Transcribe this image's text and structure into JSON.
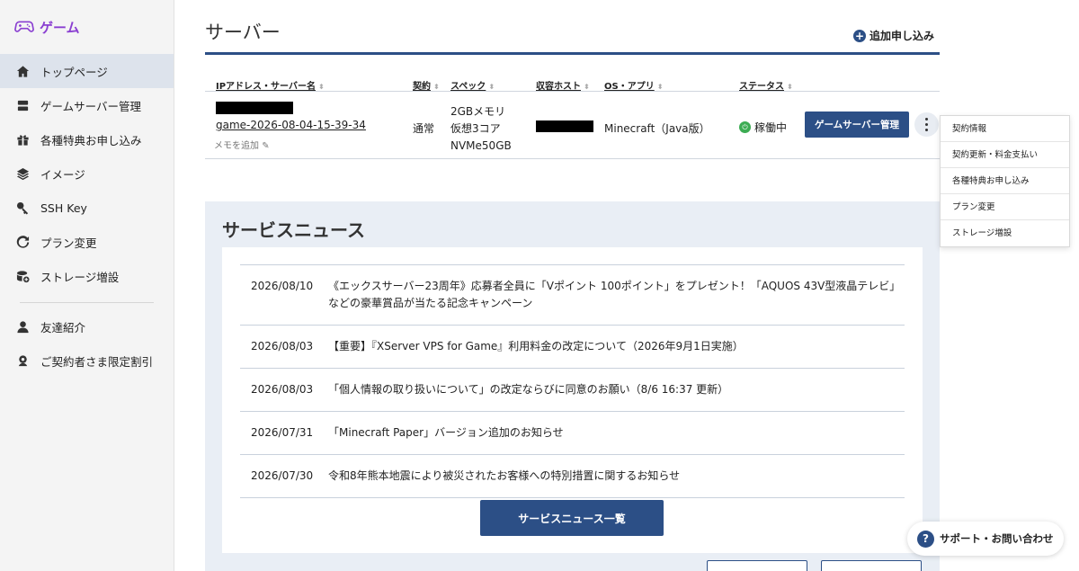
{
  "brand": {
    "name": "ゲーム",
    "icon": "gamepad-icon",
    "color": "#8a3fd1"
  },
  "sidebar": {
    "items": [
      {
        "label": "トップページ",
        "icon": "home-icon",
        "active": true
      },
      {
        "label": "ゲームサーバー管理",
        "icon": "server-icon"
      },
      {
        "label": "各種特典お申し込み",
        "icon": "gift-icon"
      },
      {
        "label": "イメージ",
        "icon": "layers-icon"
      },
      {
        "label": "SSH Key",
        "icon": "key-icon"
      },
      {
        "label": "プラン変更",
        "icon": "refresh-icon"
      },
      {
        "label": "ストレージ増設",
        "icon": "storage-add-icon"
      }
    ],
    "secondary": [
      {
        "label": "友達紹介",
        "icon": "friend-icon"
      },
      {
        "label": "ご契約者さま限定割引",
        "icon": "discount-icon"
      }
    ]
  },
  "server_section": {
    "title": "サーバー",
    "add_label": "追加申し込み",
    "columns": [
      "IPアドレス・サーバー名",
      "契約",
      "スペック",
      "収容ホスト",
      "OS・アプリ",
      "ステータス"
    ],
    "row": {
      "server_name": "game-2026-08-04-15-39-34",
      "memo": "メモを追加",
      "plan": "通常",
      "spec": [
        "2GBメモリ",
        "仮想3コア",
        "NVMe50GB"
      ],
      "os": "Minecraft（Java版）",
      "status": "稼働中",
      "manage_label": "ゲームサーバー管理"
    }
  },
  "dropdown": {
    "items": [
      "契約情報",
      "契約更新・料金支払い",
      "各種特典お申し込み",
      "プラン変更",
      "ストレージ増設"
    ]
  },
  "news": {
    "title": "サービスニュース",
    "items": [
      {
        "date": "2026/08/10",
        "text": "《エックスサーバー23周年》応募者全員に「Vポイント 100ポイント」をプレゼント！「AQUOS 43V型液晶テレビ」などの豪華賞品が当たる記念キャンペーン"
      },
      {
        "date": "2026/08/03",
        "text": "【重要】『XServer VPS for Game』利用料金の改定について（2026年9月1日実施）"
      },
      {
        "date": "2026/08/03",
        "text": "「個人情報の取り扱いについて」の改定ならびに同意のお願い（8/6 16:37 更新）"
      },
      {
        "date": "2026/07/31",
        "text": "「Minecraft Paper」バージョン追加のお知らせ"
      },
      {
        "date": "2026/07/30",
        "text": "令和8年熊本地震により被災されたお客様への特別措置に関するお知らせ"
      }
    ],
    "all_button": "サービスニュース一覧"
  },
  "support": {
    "label": "サポート・お問い合わせ",
    "icon": "question-icon"
  },
  "colors": {
    "primary": "#2c4f86",
    "status_ok": "#3cac53",
    "sidebar_bg": "#f4f4f4"
  }
}
